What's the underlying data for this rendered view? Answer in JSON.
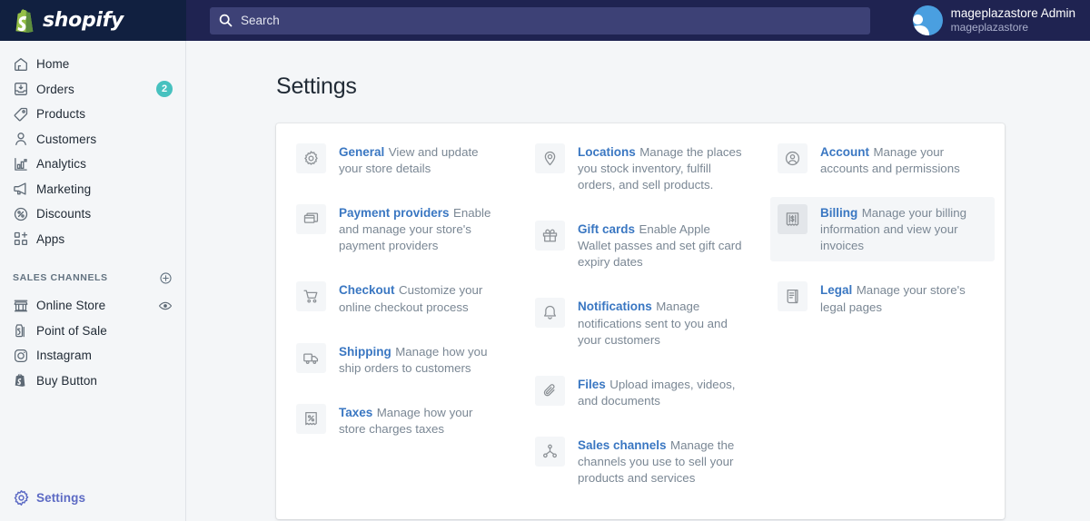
{
  "brand": {
    "name": "shopify",
    "logo_icon": "shopify-bag-icon"
  },
  "search": {
    "placeholder": "Search",
    "icon": "search-icon"
  },
  "user": {
    "name": "mageplazastore Admin",
    "store": "mageplazastore",
    "avatar_icon": "user-avatar-icon"
  },
  "sidebar": {
    "items": [
      {
        "label": "Home",
        "icon": "home-icon",
        "badge": ""
      },
      {
        "label": "Orders",
        "icon": "orders-inbox-icon",
        "badge": "2"
      },
      {
        "label": "Products",
        "icon": "tag-icon",
        "badge": ""
      },
      {
        "label": "Customers",
        "icon": "person-icon",
        "badge": ""
      },
      {
        "label": "Analytics",
        "icon": "bar-chart-icon",
        "badge": ""
      },
      {
        "label": "Marketing",
        "icon": "megaphone-icon",
        "badge": ""
      },
      {
        "label": "Discounts",
        "icon": "percent-circle-icon",
        "badge": ""
      },
      {
        "label": "Apps",
        "icon": "apps-grid-plus-icon",
        "badge": ""
      }
    ],
    "section": {
      "title": "SALES CHANNELS",
      "add_icon": "plus-circle-icon"
    },
    "channels": [
      {
        "label": "Online Store",
        "icon": "storefront-icon",
        "trailing_icon": "eye-icon"
      },
      {
        "label": "Point of Sale",
        "icon": "pos-bag-icon",
        "trailing_icon": ""
      },
      {
        "label": "Instagram",
        "icon": "instagram-icon",
        "trailing_icon": ""
      },
      {
        "label": "Buy Button",
        "icon": "buy-button-bag-icon",
        "trailing_icon": ""
      }
    ],
    "settings": {
      "label": "Settings",
      "icon": "gear-icon"
    }
  },
  "main": {
    "title": "Settings",
    "columns": [
      [
        {
          "title": "General",
          "desc": "View and update your store details",
          "icon": "gear-icon",
          "hover": false
        },
        {
          "title": "Payment providers",
          "desc": "Enable and manage your store's payment providers",
          "icon": "payment-card-icon",
          "hover": false
        },
        {
          "title": "Checkout",
          "desc": "Customize your online checkout process",
          "icon": "shopping-cart-icon",
          "hover": false
        },
        {
          "title": "Shipping",
          "desc": "Manage how you ship orders to customers",
          "icon": "truck-icon",
          "hover": false
        },
        {
          "title": "Taxes",
          "desc": "Manage how your store charges taxes",
          "icon": "tax-receipt-icon",
          "hover": false
        }
      ],
      [
        {
          "title": "Locations",
          "desc": "Manage the places you stock inventory, fulfill orders, and sell products.",
          "icon": "map-pin-icon",
          "hover": false
        },
        {
          "title": "Gift cards",
          "desc": "Enable Apple Wallet passes and set gift card expiry dates",
          "icon": "gift-icon",
          "hover": false
        },
        {
          "title": "Notifications",
          "desc": "Manage notifications sent to you and your customers",
          "icon": "bell-icon",
          "hover": false
        },
        {
          "title": "Files",
          "desc": "Upload images, videos, and documents",
          "icon": "paperclip-icon",
          "hover": false
        },
        {
          "title": "Sales channels",
          "desc": "Manage the channels you use to sell your products and services",
          "icon": "channels-node-icon",
          "hover": false
        }
      ],
      [
        {
          "title": "Account",
          "desc": "Manage your accounts and permissions",
          "icon": "account-circle-icon",
          "hover": false
        },
        {
          "title": "Billing",
          "desc": "Manage your billing information and view your invoices",
          "icon": "billing-receipt-icon",
          "hover": true
        },
        {
          "title": "Legal",
          "desc": "Manage your store's legal pages",
          "icon": "legal-scroll-icon",
          "hover": false
        }
      ]
    ]
  },
  "colors": {
    "topbar": "#1f2351",
    "brand_panel": "#112040",
    "search_field": "#3d4176",
    "sidebar_bg": "#f4f6f8",
    "accent_indigo": "#5c6ac4",
    "link_blue": "#3a77c2",
    "badge_teal": "#47c1bf",
    "text_dark": "#212b36",
    "text_muted": "#7a8794"
  }
}
